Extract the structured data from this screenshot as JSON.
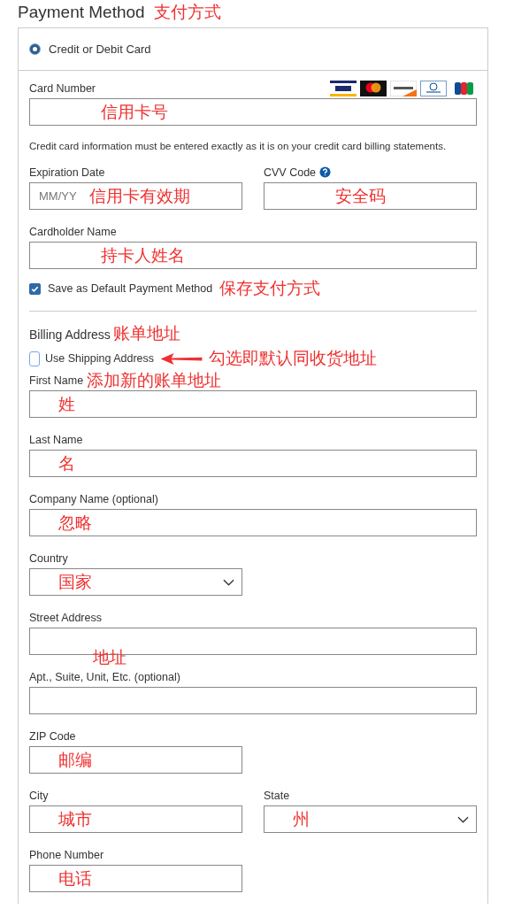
{
  "title": "Payment Method",
  "title_note": "支付方式",
  "payment_option": {
    "label": "Credit or Debit Card",
    "selected": true
  },
  "card_rows": [
    {
      "fields": [
        {
          "kind": "text-wide",
          "label": "Card Number",
          "logos": true,
          "note": "信用卡号"
        }
      ]
    },
    {
      "info": "Credit card information must be entered exactly as it is on your credit card billing statements."
    },
    {
      "fields": [
        {
          "kind": "text-half",
          "label": "Expiration Date",
          "placeholder": "MM/YY",
          "note": "信用卡有效期"
        },
        {
          "kind": "text-half",
          "label": "CVV Code",
          "help": true,
          "note": "安全码"
        }
      ]
    },
    {
      "fields": [
        {
          "kind": "text-wide",
          "label": "Cardholder Name",
          "note": "持卡人姓名"
        }
      ]
    }
  ],
  "save_default": {
    "label": "Save as Default Payment Method",
    "checked": true,
    "note": "保存支付方式"
  },
  "billing": {
    "label": "Billing Address",
    "note": "账单地址"
  },
  "use_shipping": {
    "label": "Use Shipping Address",
    "checked": false,
    "note": "勾选即默认同收货地址"
  },
  "billing_rows": [
    {
      "fields": [
        {
          "kind": "text-wide",
          "label": "First Name",
          "label_note": "添加新的账单地址",
          "note": "姓"
        }
      ]
    },
    {
      "fields": [
        {
          "kind": "text-wide",
          "label": "Last Name",
          "note": "名"
        }
      ]
    },
    {
      "fields": [
        {
          "kind": "text-wide",
          "label": "Company Name (optional)",
          "note": "忽略"
        }
      ]
    },
    {
      "fields": [
        {
          "kind": "select-half",
          "label": "Country",
          "note": "国家"
        }
      ]
    },
    {
      "fields": [
        {
          "kind": "text-wide",
          "label": "Street Address",
          "note_below": "地址"
        }
      ]
    },
    {
      "fields": [
        {
          "kind": "text-wide",
          "label": "Apt., Suite, Unit, Etc. (optional)"
        }
      ]
    },
    {
      "fields": [
        {
          "kind": "text-half",
          "label": "ZIP Code",
          "note": "邮编"
        }
      ]
    },
    {
      "fields": [
        {
          "kind": "text-half",
          "label": "City",
          "note": "城市"
        },
        {
          "kind": "select-half",
          "label": "State",
          "note": "州"
        }
      ]
    },
    {
      "fields": [
        {
          "kind": "text-half",
          "label": "Phone Number",
          "note": "电话"
        }
      ]
    }
  ]
}
